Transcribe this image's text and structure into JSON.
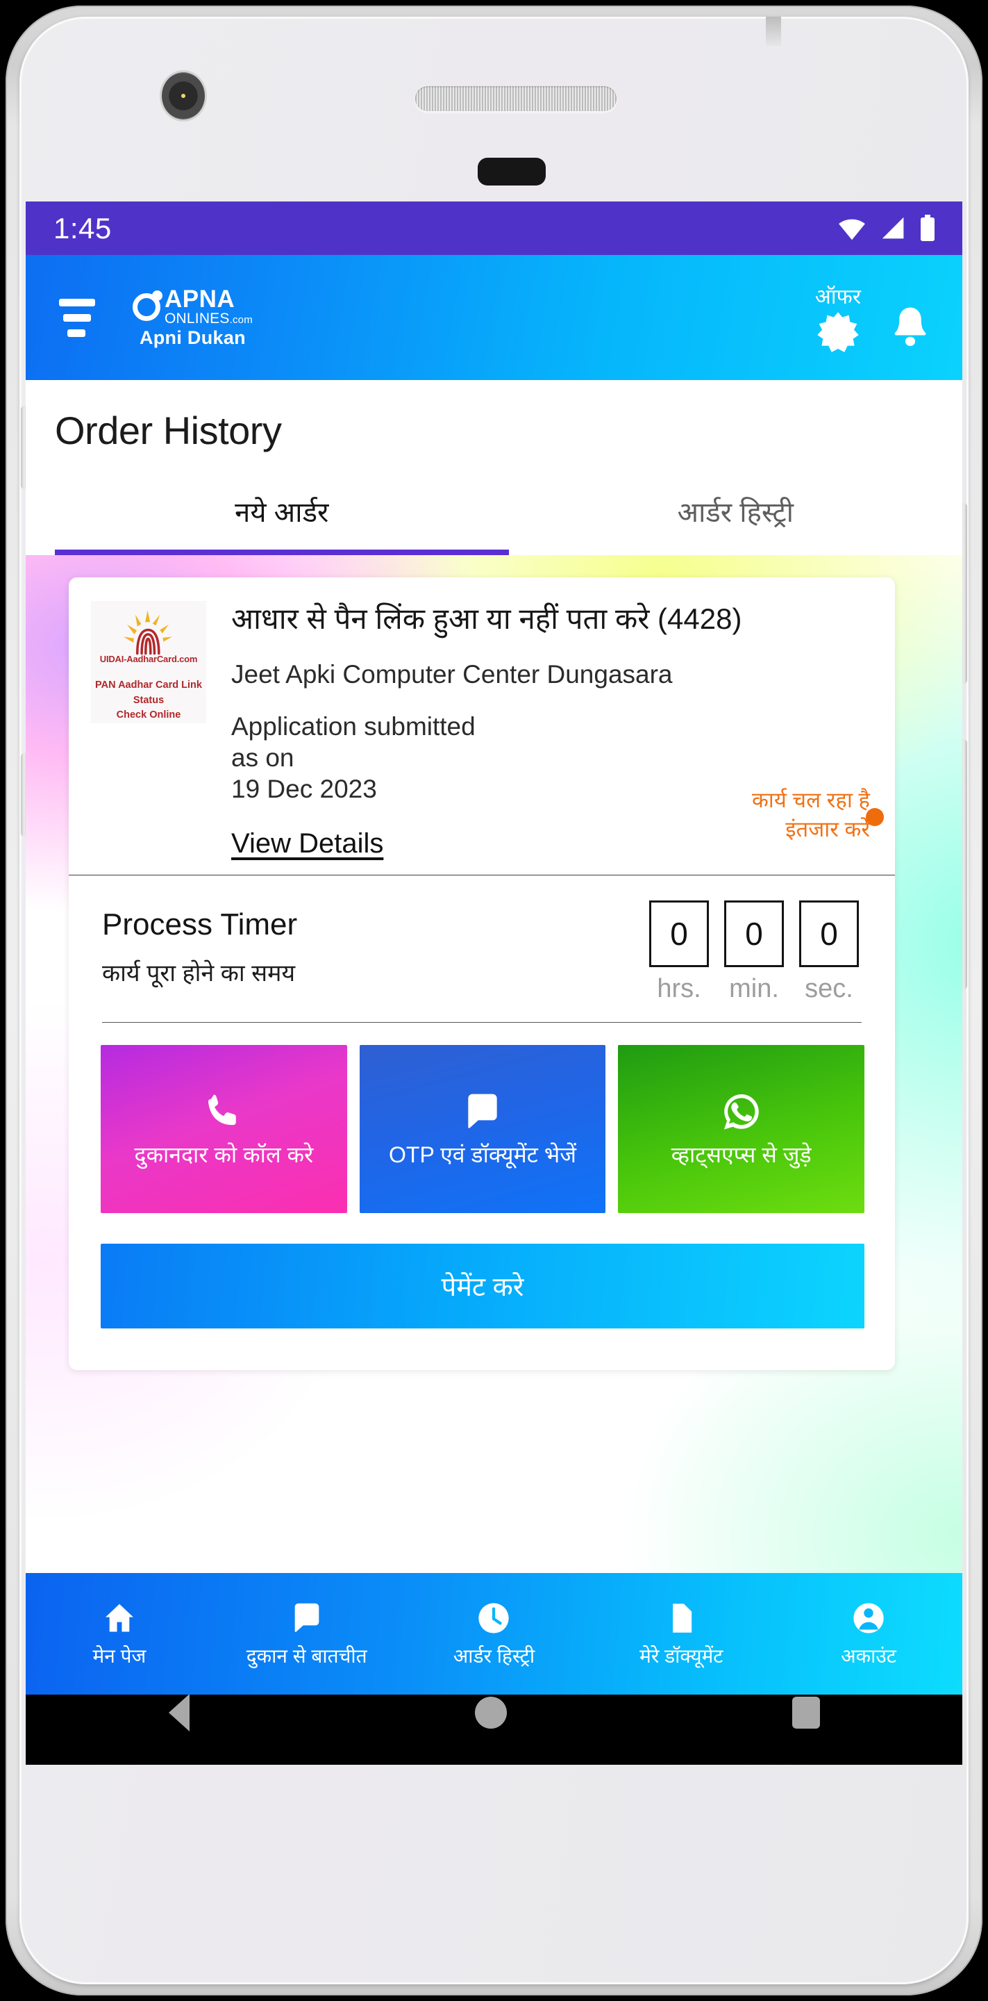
{
  "status_bar": {
    "time": "1:45",
    "icons": [
      "wifi-icon",
      "cellular-signal-icon",
      "battery-icon"
    ]
  },
  "app_bar": {
    "menu_icon": "hamburger-menu-icon",
    "brand_name": "APNA",
    "brand_domain": "ONLINES",
    "brand_domain_suffix": ".com",
    "brand_tagline": "Apni Dukan",
    "offer_label": "ऑफर",
    "offer_icon": "starburst-offer-icon",
    "notification_icon": "bell-icon"
  },
  "page": {
    "title": "Order History"
  },
  "tabs": [
    {
      "label": "नये आर्डर",
      "active": true
    },
    {
      "label": "आर्डर हिस्ट्री",
      "active": false
    }
  ],
  "order_card": {
    "thumbnail": {
      "logo_icon": "uidai-aadhaar-fingerprint-icon",
      "domain": "UIDAI-AadharCard.com",
      "caption_line1": "PAN Aadhar Card Link Status",
      "caption_line2": "Check Online"
    },
    "title": "आधार से पैन लिंक हुआ या नहीं पता करे (4428)",
    "shop_name": "Jeet Apki Computer Center Dungasara",
    "submitted_line1": "Application submitted",
    "submitted_line2": "as on",
    "submitted_date": "19 Dec 2023",
    "view_details_label": "View Details",
    "status_line1": "कार्य चल रहा है",
    "status_line2": "इंतजार करे",
    "status_color": "#ef6c0d"
  },
  "process_timer": {
    "title": "Process Timer",
    "subtitle": "कार्य पूरा होने का समय",
    "units": [
      {
        "value": "0",
        "label": "hrs."
      },
      {
        "value": "0",
        "label": "min."
      },
      {
        "value": "0",
        "label": "sec."
      }
    ]
  },
  "action_buttons": [
    {
      "label": "दुकानदार को कॉल करे",
      "icon": "phone-call-icon",
      "color_start": "#b52be0",
      "color_end": "#fb2fb0"
    },
    {
      "label": "OTP एवं डॉक्यूमेंट भेजें",
      "icon": "chat-bubble-icon",
      "color_start": "#2f5fd2",
      "color_end": "#0f73f7"
    },
    {
      "label": "व्हाट्सएप्स से जुड़े",
      "icon": "whatsapp-icon",
      "color_start": "#1f9b12",
      "color_end": "#6ddd10"
    }
  ],
  "payment_button": {
    "label": "पेमेंट करे"
  },
  "bottom_nav": [
    {
      "label": "मेन पेज",
      "icon": "home-icon"
    },
    {
      "label": "दुकान से बातचीत",
      "icon": "chat-bubble-icon"
    },
    {
      "label": "आर्डर हिस्ट्री",
      "icon": "clock-icon"
    },
    {
      "label": "मेरे डॉक्यूमेंट",
      "icon": "document-icon"
    },
    {
      "label": "अकाउंट",
      "icon": "account-person-icon"
    }
  ],
  "android_nav": {
    "back_icon": "back-triangle-icon",
    "home_icon": "home-circle-icon",
    "recents_icon": "recents-square-icon"
  }
}
